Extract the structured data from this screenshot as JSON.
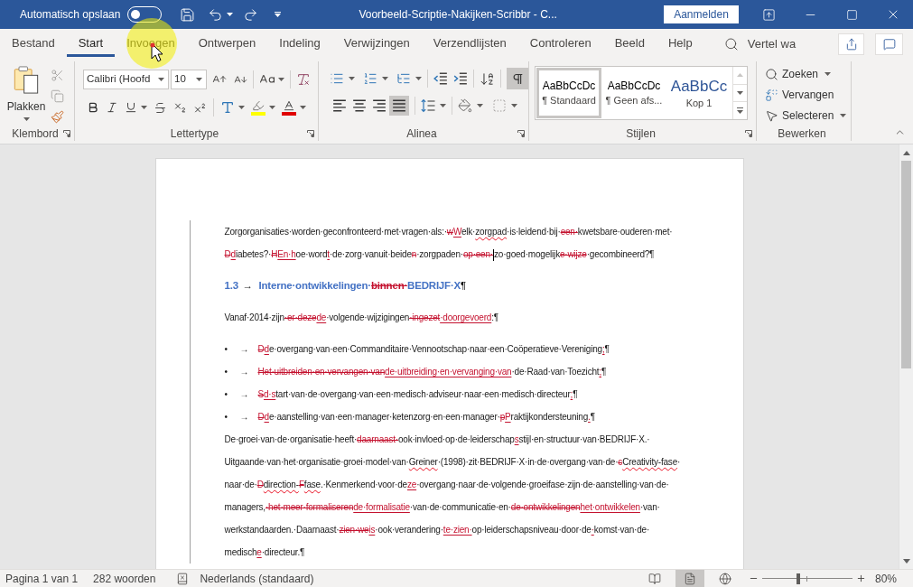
{
  "title_bar": {
    "autosave_label": "Automatisch opslaan",
    "autosave": {
      "on": false
    },
    "title": "Voorbeeld-Scriptie-Nakijken-Scribbr - C...",
    "sign_in": "Aanmelden"
  },
  "tabs": [
    {
      "label": "Bestand",
      "selected": false
    },
    {
      "label": "Start",
      "selected": true
    },
    {
      "label": "Invoegen",
      "selected": false
    },
    {
      "label": "Ontwerpen",
      "selected": false
    },
    {
      "label": "Indeling",
      "selected": false
    },
    {
      "label": "Verwijzingen",
      "selected": false
    },
    {
      "label": "Verzendlijsten",
      "selected": false
    },
    {
      "label": "Controleren",
      "selected": false
    },
    {
      "label": "Beeld",
      "selected": false
    },
    {
      "label": "Help",
      "selected": false
    }
  ],
  "tell_me": {
    "placeholder": "Vertel wa"
  },
  "mouse_pointer": {
    "highlight": true
  },
  "ribbon": {
    "clipboard": {
      "paste": "Plakken",
      "tools": [
        {
          "kind": "cut",
          "disabled": true
        },
        {
          "kind": "copy",
          "disabled": true
        },
        {
          "kind": "format_painter",
          "disabled": false
        }
      ],
      "label": "Klembord"
    },
    "font": {
      "name": "Calibri (Hoofd",
      "size": "10",
      "label": "Lettertype"
    },
    "paragraph": {
      "show_marks": {
        "on": true
      },
      "alignment": [
        {
          "kind": "left",
          "selected": false
        },
        {
          "kind": "center",
          "selected": false
        },
        {
          "kind": "right",
          "selected": false
        },
        {
          "kind": "justify",
          "selected": true
        }
      ],
      "label": "Alinea"
    },
    "styles": {
      "items": [
        {
          "kind": "body",
          "preview": "AaBbCcDc",
          "name": "¶ Standaard",
          "selected": true
        },
        {
          "kind": "body",
          "preview": "AaBbCcDc",
          "name": "¶ Geen afs...",
          "selected": false
        },
        {
          "kind": "heading",
          "preview": "AaBbCc",
          "name": "Kop 1",
          "selected": false
        }
      ],
      "label": "Stijlen"
    },
    "editing": {
      "items": [
        {
          "kind": "find",
          "label": "Zoeken",
          "dropdown": true
        },
        {
          "kind": "replace",
          "label": "Vervangen",
          "dropdown": false
        },
        {
          "kind": "select",
          "label": "Selecteren",
          "dropdown": true
        }
      ],
      "label": "Bewerken"
    }
  },
  "document": {
    "blocks": [
      {
        "kind": "paragraph",
        "lines": [
          [
            {
              "kind": "text",
              "text": "Zorgorganisaties·worden·geconfronteerd·met·vragen·als:·"
            },
            {
              "kind": "deleted",
              "text": "w"
            },
            {
              "kind": "inserted",
              "text": "W"
            },
            {
              "kind": "text",
              "text": "elk·"
            },
            {
              "kind": "misspelled",
              "text": "zorgpad"
            },
            {
              "kind": "text",
              "text": "·is·leidend·bij·"
            },
            {
              "kind": "deleted",
              "text": "een·"
            },
            {
              "kind": "text",
              "text": "kwetsbare·ouderen·met·"
            }
          ],
          [
            {
              "kind": "deleted",
              "text": "D"
            },
            {
              "kind": "inserted",
              "text": "d"
            },
            {
              "kind": "text",
              "text": "iabetes?·"
            },
            {
              "kind": "deleted",
              "text": "H"
            },
            {
              "kind": "inserted",
              "text": "En·h"
            },
            {
              "kind": "text",
              "text": "oe·word"
            },
            {
              "kind": "inserted",
              "text": "t"
            },
            {
              "kind": "text",
              "text": "·de·zorg·vanuit·beide"
            },
            {
              "kind": "deleted",
              "text": "n"
            },
            {
              "kind": "text",
              "text": "·zorgpaden·"
            },
            {
              "kind": "deleted",
              "text": "op·een·"
            },
            {
              "kind": "caret"
            },
            {
              "kind": "text",
              "text": "zo·goed·mogelijk"
            },
            {
              "kind": "deleted",
              "text": "e·wijze"
            },
            {
              "kind": "text",
              "text": "·gecombineerd?¶"
            }
          ]
        ]
      },
      {
        "kind": "heading",
        "number": "1.3",
        "tab": "→",
        "lines": [
          [
            {
              "kind": "text",
              "text": "Interne·ontwikkelingen·"
            },
            {
              "kind": "deleted",
              "text": "binnen·"
            },
            {
              "kind": "text",
              "text": "BEDRIJF·X"
            },
            {
              "kind": "mark",
              "text": "¶"
            }
          ]
        ]
      },
      {
        "kind": "paragraph",
        "lines": [
          [
            {
              "kind": "text",
              "text": "Vanaf·2014·zijn"
            },
            {
              "kind": "deleted",
              "text": "·er·deze"
            },
            {
              "kind": "inserted",
              "text": "de"
            },
            {
              "kind": "text",
              "text": "·volgende·wijzigingen"
            },
            {
              "kind": "deleted",
              "text": "·ingezet"
            },
            {
              "kind": "inserted",
              "text": "·doorgevoerd"
            },
            {
              "kind": "text",
              "text": ":¶"
            }
          ]
        ]
      },
      {
        "kind": "bullet",
        "bullet": "•",
        "tab": "→",
        "lines": [
          [
            {
              "kind": "deleted",
              "text": "D"
            },
            {
              "kind": "inserted",
              "text": "d"
            },
            {
              "kind": "text",
              "text": "e·overgang·van·een·Commanditaire·Vennootschap·naar·een·Coöperatieve·Vereniging"
            },
            {
              "kind": "inserted",
              "text": ";"
            },
            {
              "kind": "text",
              "text": "¶"
            }
          ]
        ]
      },
      {
        "kind": "bullet",
        "bullet": "•",
        "tab": "→",
        "lines": [
          [
            {
              "kind": "deleted",
              "text": "Het·uitbreiden·en·vervangen·van"
            },
            {
              "kind": "inserted",
              "text": "de·uitbreiding·en·vervanging·van"
            },
            {
              "kind": "text",
              "text": "·de·Raad·van·Toezicht"
            },
            {
              "kind": "inserted",
              "text": ";"
            },
            {
              "kind": "text",
              "text": "¶"
            }
          ]
        ]
      },
      {
        "kind": "bullet",
        "bullet": "•",
        "tab": "→",
        "lines": [
          [
            {
              "kind": "deleted",
              "text": "S"
            },
            {
              "kind": "inserted",
              "text": "d·s"
            },
            {
              "kind": "text",
              "text": "tart·van·de·overgang·van·een·medisch·adviseur·naar·een·medisch·directeur"
            },
            {
              "kind": "inserted",
              "text": ";"
            },
            {
              "kind": "text",
              "text": "¶"
            }
          ]
        ]
      },
      {
        "kind": "bullet",
        "bullet": "•",
        "tab": "→",
        "lines": [
          [
            {
              "kind": "deleted",
              "text": "D"
            },
            {
              "kind": "inserted",
              "text": "d"
            },
            {
              "kind": "text",
              "text": "e·aanstelling·van·een·manager·ketenzorg·en·een·manager·"
            },
            {
              "kind": "deleted",
              "text": "p"
            },
            {
              "kind": "inserted",
              "text": "P"
            },
            {
              "kind": "text",
              "text": "raktijkondersteuning"
            },
            {
              "kind": "inserted",
              "text": "."
            },
            {
              "kind": "text",
              "text": "¶"
            }
          ]
        ]
      },
      {
        "kind": "paragraph",
        "lines": [
          [
            {
              "kind": "text",
              "text": "De·groei·van·de·organisatie·heeft·"
            },
            {
              "kind": "deleted",
              "text": "daarnaast·"
            },
            {
              "kind": "text",
              "text": "ook·invloed·op·de·leiderschap"
            },
            {
              "kind": "inserted",
              "text": "s"
            },
            {
              "kind": "text",
              "text": "stijl·en·structuur·van·BEDRIJF·X.·"
            }
          ],
          [
            {
              "kind": "text",
              "text": "Uitgaande·van·het·organisatie·groei·model·van·"
            },
            {
              "kind": "misspelled",
              "text": "Greiner"
            },
            {
              "kind": "text",
              "text": "·(1998)·zit·BEDRIJF·X·in·de·overgang·van·de·"
            },
            {
              "kind": "deleted",
              "text": "c"
            },
            {
              "kind": "misspelled",
              "text": "Creativity-fase"
            },
            {
              "kind": "text",
              "text": "·"
            }
          ],
          [
            {
              "kind": "text",
              "text": "naar·de·"
            },
            {
              "kind": "deleted",
              "text": "D"
            },
            {
              "kind": "misspelled",
              "text": "direction-"
            },
            {
              "kind": "deleted",
              "text": "F"
            },
            {
              "kind": "misspelled",
              "text": "fase"
            },
            {
              "kind": "text",
              "text": ".·Kenmerkend·voor·de"
            },
            {
              "kind": "inserted",
              "text": "ze"
            },
            {
              "kind": "text",
              "text": "·overgang·naar·de·volgende·groeifase·zijn·de·aanstelling·van·de·"
            }
          ],
          [
            {
              "kind": "text",
              "text": "managers,"
            },
            {
              "kind": "deleted",
              "text": "·het·meer·formaliseren"
            },
            {
              "kind": "inserted",
              "text": "de·formalisatie"
            },
            {
              "kind": "text",
              "text": "·van·de·communicatie·en·"
            },
            {
              "kind": "deleted",
              "text": "de·ontwikkelingen"
            },
            {
              "kind": "inserted",
              "text": "het·ontwikkelen"
            },
            {
              "kind": "text",
              "text": "·van·"
            }
          ],
          [
            {
              "kind": "text",
              "text": "werkstandaarden.·Daarnaast·"
            },
            {
              "kind": "deleted",
              "text": "zien·we"
            },
            {
              "kind": "inserted",
              "text": "is"
            },
            {
              "kind": "text",
              "text": "·ook·verandering·"
            },
            {
              "kind": "inserted",
              "text": "te·zien·"
            },
            {
              "kind": "text",
              "text": "op·leiderschapsniveau·door·de"
            },
            {
              "kind": "inserted",
              "text": "·"
            },
            {
              "kind": "text",
              "text": "komst·van·de·"
            }
          ],
          [
            {
              "kind": "text",
              "text": "medisch"
            },
            {
              "kind": "inserted",
              "text": "e"
            },
            {
              "kind": "text",
              "text": "·directeur.¶"
            }
          ]
        ]
      }
    ]
  },
  "status_bar": {
    "page": "Pagina 1 van 1",
    "words": "282 woorden",
    "language": "Nederlands (standaard)",
    "views": [
      {
        "kind": "read",
        "selected": false
      },
      {
        "kind": "print",
        "selected": true
      },
      {
        "kind": "web",
        "selected": false
      }
    ],
    "zoom": {
      "level": 0.4,
      "reading": "80%"
    }
  }
}
